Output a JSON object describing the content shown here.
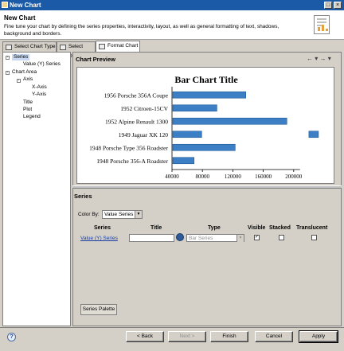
{
  "window": {
    "title": "New Chart"
  },
  "header": {
    "title": "New Chart",
    "description": "Fine tune your chart by defining the series properties, interactivity, layout, as well as general formatting of text, shadows, background and borders."
  },
  "tabs": [
    {
      "label": "Select Chart Type"
    },
    {
      "label": "Select Data"
    },
    {
      "label": "Format Chart"
    }
  ],
  "tree": {
    "series": "Series",
    "value_series": "Value (Y) Series",
    "chart_area": "Chart Area",
    "axis": "Axis",
    "x_axis": "X-Axis",
    "y_axis": "Y-Axis",
    "title": "Title",
    "plot": "Plot",
    "legend": "Legend"
  },
  "preview": {
    "heading": "Chart Preview",
    "nav_back": "←",
    "nav_forward": "→",
    "nav_menu": "▾"
  },
  "chart_data": {
    "type": "bar",
    "orientation": "horizontal",
    "title": "Bar Chart Title",
    "categories": [
      "1956 Porsche 356A Coupe",
      "1952 Citroen-15CV",
      "1952 Alpine Renault 1300",
      "1949 Jaguar XK 120",
      "1948 Porsche Type 356 Roadster",
      "1948 Porsche 356-A Roadster"
    ],
    "values": [
      136000,
      98000,
      190000,
      78000,
      122000,
      68000
    ],
    "overflow_value": 220000,
    "xlim": [
      40000,
      240000
    ],
    "xticks": [
      "40000",
      "80000",
      "120000",
      "160000",
      "200000"
    ],
    "tick_values": [
      40000,
      80000,
      120000,
      160000,
      200000
    ],
    "bar_color": "#3c7fc4",
    "legend": "none",
    "grid": false
  },
  "series_section": {
    "heading": "Series",
    "color_by_label": "Color By:",
    "color_by_value": "Value Series",
    "columns": {
      "series": "Series",
      "title": "Title",
      "type": "Type",
      "visible": "Visible",
      "stacked": "Stacked",
      "translucent": "Translucent"
    },
    "row": {
      "series_link": "Value (Y) Series",
      "title_value": "",
      "type_value": "Bar Series",
      "visible": "✓",
      "stacked": "",
      "translucent": ""
    },
    "palette_button": "Series Palette"
  },
  "footer": {
    "help": "?",
    "back": "< Back",
    "next": "Next >",
    "finish": "Finish",
    "cancel": "Cancel",
    "apply": "Apply"
  },
  "colors": {
    "titlebar": "#1b5aa6",
    "bar": "#3c7fc4",
    "dialog_bg": "#d4d0c8",
    "link": "#1a3fa0"
  }
}
